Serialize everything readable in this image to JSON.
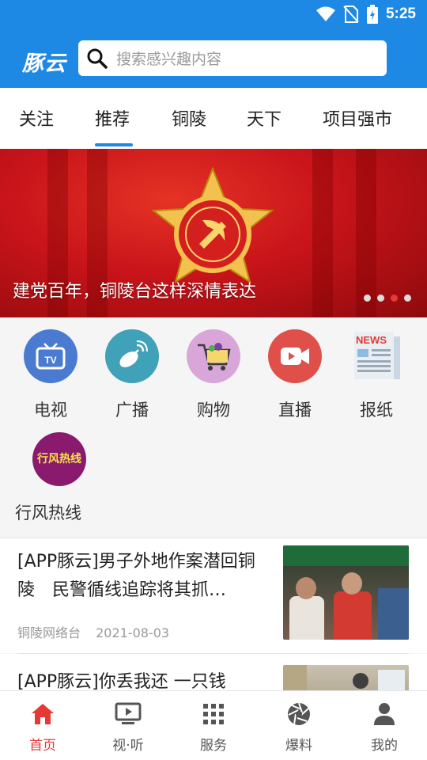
{
  "status": {
    "time": "5:25"
  },
  "app": {
    "logo": "豚云"
  },
  "search": {
    "placeholder": "搜索感兴趣内容"
  },
  "tabs": [
    {
      "label": "关注"
    },
    {
      "label": "推荐",
      "active": true
    },
    {
      "label": "铜陵"
    },
    {
      "label": "天下"
    },
    {
      "label": "项目强市"
    }
  ],
  "banner": {
    "caption": "建党百年，铜陵台这样深情表达",
    "slide_count": 4,
    "active_slide": 3
  },
  "shortcuts": [
    {
      "label": "电视",
      "icon": "tv-icon",
      "color": "#4a7bd0"
    },
    {
      "label": "广播",
      "icon": "radio-dish-icon",
      "color": "#3fa2b8"
    },
    {
      "label": "购物",
      "icon": "shopping-cart-icon",
      "color": "#d8a6d8"
    },
    {
      "label": "直播",
      "icon": "video-camera-icon",
      "color": "#e0504a"
    },
    {
      "label": "报纸",
      "icon": "newspaper-icon",
      "icon_text": "NEWS",
      "color": "#e53935"
    },
    {
      "label": "行风热线",
      "icon": "hotline-logo-icon",
      "icon_text": "行风热线",
      "color": "#8a1a6e"
    }
  ],
  "news": [
    {
      "title": "[APP豚云]男子外地作案潜回铜陵　民警循线追踪将其抓…",
      "source": "铜陵网络台",
      "date": "2021-08-03"
    },
    {
      "title": "[APP豚云]你丢我还 一只钱"
    }
  ],
  "bottom_nav": [
    {
      "label": "首页",
      "icon": "home-icon",
      "active": true
    },
    {
      "label": "视·听",
      "icon": "play-screen-icon"
    },
    {
      "label": "服务",
      "icon": "grid-icon"
    },
    {
      "label": "爆料",
      "icon": "aperture-icon"
    },
    {
      "label": "我的",
      "icon": "user-icon"
    }
  ],
  "colors": {
    "primary": "#1e88e5",
    "accent": "#e53935"
  }
}
